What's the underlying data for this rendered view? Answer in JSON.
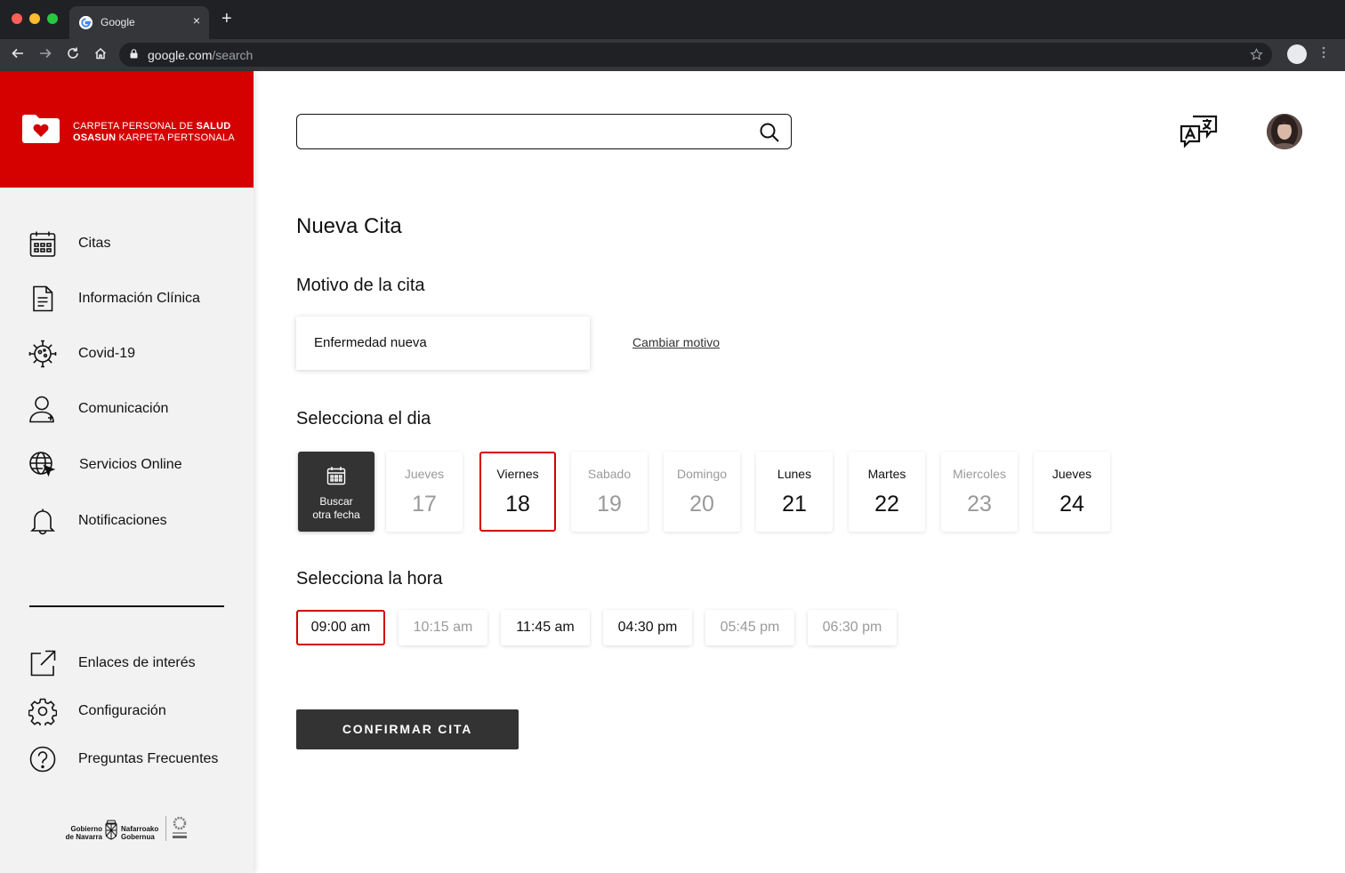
{
  "browser": {
    "tab_title": "Google",
    "tab_close": "×",
    "new_tab": "+",
    "url_host": "google.com",
    "url_path": "/search"
  },
  "brand": {
    "line1_prefix": "CARPETA PERSONAL DE ",
    "line1_bold": "SALUD",
    "line2_bold": "OSASUN",
    "line2_suffix": " KARPETA PERTSONALA",
    "accent": "#d50000"
  },
  "sidebar": {
    "items": [
      {
        "label": "Citas",
        "icon": "calendar-icon"
      },
      {
        "label": "Información Clínica",
        "icon": "document-icon"
      },
      {
        "label": "Covid-19",
        "icon": "virus-icon"
      },
      {
        "label": "Comunicación",
        "icon": "user-icon"
      },
      {
        "label": "Servicios Online",
        "icon": "globe-cursor-icon"
      },
      {
        "label": "Notificaciones",
        "icon": "bell-icon"
      }
    ],
    "secondary": [
      {
        "label": "Enlaces de interés",
        "icon": "external-link-icon"
      },
      {
        "label": "Configuración",
        "icon": "gear-icon"
      },
      {
        "label": "Preguntas Frecuentes",
        "icon": "help-icon"
      }
    ],
    "footer": {
      "gov_left_1": "Gobierno",
      "gov_left_2": "de Navarra",
      "gov_right_1": "Nafarroako",
      "gov_right_2": "Gobernua"
    }
  },
  "main": {
    "title": "Nueva Cita",
    "reason_heading": "Motivo de la cita",
    "reason_value": "Enfermedad nueva",
    "change_reason": "Cambiar motivo",
    "day_heading": "Selecciona el dia",
    "search_other_line1": "Buscar",
    "search_other_line2": "otra fecha",
    "days": [
      {
        "name": "Jueves",
        "num": "17",
        "state": "disabled"
      },
      {
        "name": "Viernes",
        "num": "18",
        "state": "selected"
      },
      {
        "name": "Sabado",
        "num": "19",
        "state": "disabled"
      },
      {
        "name": "Domingo",
        "num": "20",
        "state": "disabled"
      },
      {
        "name": "Lunes",
        "num": "21",
        "state": "enabled"
      },
      {
        "name": "Martes",
        "num": "22",
        "state": "enabled"
      },
      {
        "name": "Miercoles",
        "num": "23",
        "state": "disabled"
      },
      {
        "name": "Jueves",
        "num": "24",
        "state": "enabled"
      }
    ],
    "time_heading": "Selecciona la hora",
    "times": [
      {
        "label": "09:00 am",
        "state": "selected"
      },
      {
        "label": "10:15 am",
        "state": "disabled"
      },
      {
        "label": "11:45 am",
        "state": "enabled"
      },
      {
        "label": "04:30 pm",
        "state": "enabled"
      },
      {
        "label": "05:45 pm",
        "state": "disabled"
      },
      {
        "label": "06:30 pm",
        "state": "disabled"
      }
    ],
    "confirm_label": "CONFIRMAR CITA"
  }
}
